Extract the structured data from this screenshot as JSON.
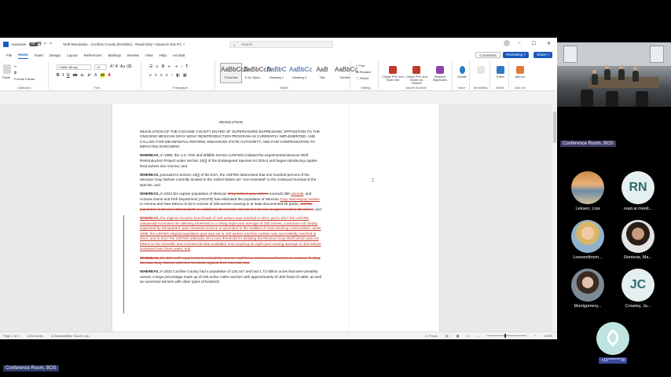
{
  "word": {
    "titlebar": {
      "autosave_label": "AutoSave",
      "autosave_state": "Off",
      "title": "Wolf Resolution - Cochise County (DH1801) - Read-Only • Saved to this PC ˅",
      "search_placeholder": "Search"
    },
    "menu_tabs": [
      "File",
      "Home",
      "Insert",
      "Design",
      "Layout",
      "References",
      "Mailings",
      "Review",
      "View",
      "Help",
      "Acrobat"
    ],
    "active_tab": "Home",
    "comments_label": "Comments",
    "reviewing_label": "Reviewing",
    "share_label": "Share",
    "ribbon": {
      "clipboard": {
        "paste": "Paste",
        "cut": "✂",
        "copy": "⧉",
        "format_painter": "Format Painter",
        "label": "Clipboard"
      },
      "font": {
        "name": "Calibri (Body)",
        "size": "12",
        "label": "Font"
      },
      "paragraph": {
        "label": "Paragraph"
      },
      "styles": {
        "items": [
          {
            "preview": "AaBbCcD",
            "name": "¶ Normal"
          },
          {
            "preview": "AaBbCcD",
            "name": "¶ No Spac..."
          },
          {
            "preview": "AaBbC",
            "name": "Heading 1"
          },
          {
            "preview": "AaBbCc",
            "name": "Heading 2"
          },
          {
            "preview": "AaB",
            "name": "Title"
          },
          {
            "preview": "AaBbCc",
            "name": "Subtitle"
          }
        ],
        "label": "Styles"
      },
      "editing": {
        "find": "Find",
        "replace": "Replace",
        "select": "Select",
        "label": "Editing"
      },
      "acrobat": {
        "items": [
          "Create PDF and Share link",
          "Create PDF and Share via Outlook",
          "Request Signatures"
        ],
        "label": "Adobe Acrobat"
      },
      "voice": {
        "dictate": "Dictate",
        "label": "Voice"
      },
      "sensitivity": {
        "label": "Sensitivity"
      },
      "editor": {
        "label": "Editor",
        "item": "Editor"
      },
      "addins": {
        "label": "Add-ins",
        "item": "Add-ins"
      }
    },
    "document": {
      "title": "RESOLUTION",
      "p1": "RESOLUTION OF THE COCHISE COUNTY BOARD OF SUPERVISORS EXPRESSING OPPOSITION TO THE ONGOING MEXICAN GRAY WOLF REINTRODUCTION PROGRAM AS CURRENTLY IMPLEMENTED, AND CALLING FOR MEANINGFUL REFORM, ENHANCED STATE AUTHORITY, AND FAIR COMPENSATION TO IMPACTED RANCHERS",
      "p2_lead": "WHEREAS,",
      "p2": " in 1998, the U.S. Fish and Wildlife Service (USFWS) initiated the experimental Mexican Wolf Reintroduction Project under Section 10(j) of the Endangered Species Act (ESA) and began introducing captive bred wolves into Arizona; and",
      "p3_lead": "WHEREAS,",
      "p3": " pursuant to Section 10(j) of the ESA, the USFWS determined that one hundred percent of the Mexican Gray Wolves currently located in the United States are \"non-essential\" to the continued survival of the species; and",
      "p4_lead": "WHEREAS,",
      "p4_a": " in 2024 the captive population of Mexican ",
      "p4_del1": "Gray Wolves gray wolves",
      "p4_b": " exceeds 350 ",
      "p4_ins1": "animals",
      "p4_c": ", and Arizona Game and Fish Department (AZGFD) has estimated the population of Mexican ",
      "p4_ins2": "Gray Wolvesgray wolves",
      "p4_d": " in Arizona and New Mexico to be in excess of 286 wolves roaming in at least documented 60 packs, ",
      "p4_del2": "and the population in Mexico estimatedwith an additional 40 animals estimated in Mexico",
      "p4_del3": " at approximately 40 wolves",
      "p4_e": "; and",
      "p5_lead": "WHEREAS,",
      "p5_ins": " the original recovery benchmark of 100 wolves was reached in 2014, yet in 2017 the USFWS unilaterally increased the delisting threshold to a rolling eight-year average of 320 wolves, a decision not clearly supported by transparent, peer reviewed science or grounded in the realities of rural ranching communities; andIn 1998, the USFWS original population goal was set at 100 wolves and this number was successfully reached in 2014, and in 2017 the USFWS arbitrarily set a new threshold for delisting the Mexican Gray Wolf (which was not based on the scientific and commercial data available) now requiring an eight-year moving average of 320 wolves sustained over three years; and",
      "p6_lead": "WHEREAS,",
      "p6_del": " the 320-wolf requirement is not built by science and forces ranchers and farmers to continue feeding Mexican Gray Wolves with their livestock, against their interests; and",
      "p7_lead": "WHEREAS,",
      "p7": " in 2022 Cochise County had a population of 125,447 and had 1.73 million acres that were privately owned, a large percentage made up of 335 active cattle ranches with approximately 57,000 head of cattle, as well as numerous farmers with other types of livestock;"
    },
    "statusbar": {
      "page": "Page 1 of 5",
      "words": "1103 words",
      "accessibility": "Accessibility: Good to go",
      "focus": "Focus",
      "zoom": "100%"
    }
  },
  "meeting": {
    "room_label": "Conference Room, BOS",
    "bottom_label": "Conference Room, BOS",
    "participants": [
      {
        "name": "Leksen, Lisa",
        "initials": "",
        "kind": "beach"
      },
      {
        "name": "read.ai meeti...",
        "initials": "RN",
        "kind": "initials"
      },
      {
        "name": "Loewentheim...",
        "initials": "",
        "kind": "blonde1"
      },
      {
        "name": "Renteria, Ma...",
        "initials": "",
        "kind": "dark1"
      },
      {
        "name": "Montgomery...",
        "initials": "",
        "kind": "dark2"
      },
      {
        "name": "Crowley, Ja...",
        "initials": "JC",
        "kind": "initials"
      }
    ],
    "phone": {
      "label": "+15*******78",
      "icon": "phone-icon"
    }
  }
}
